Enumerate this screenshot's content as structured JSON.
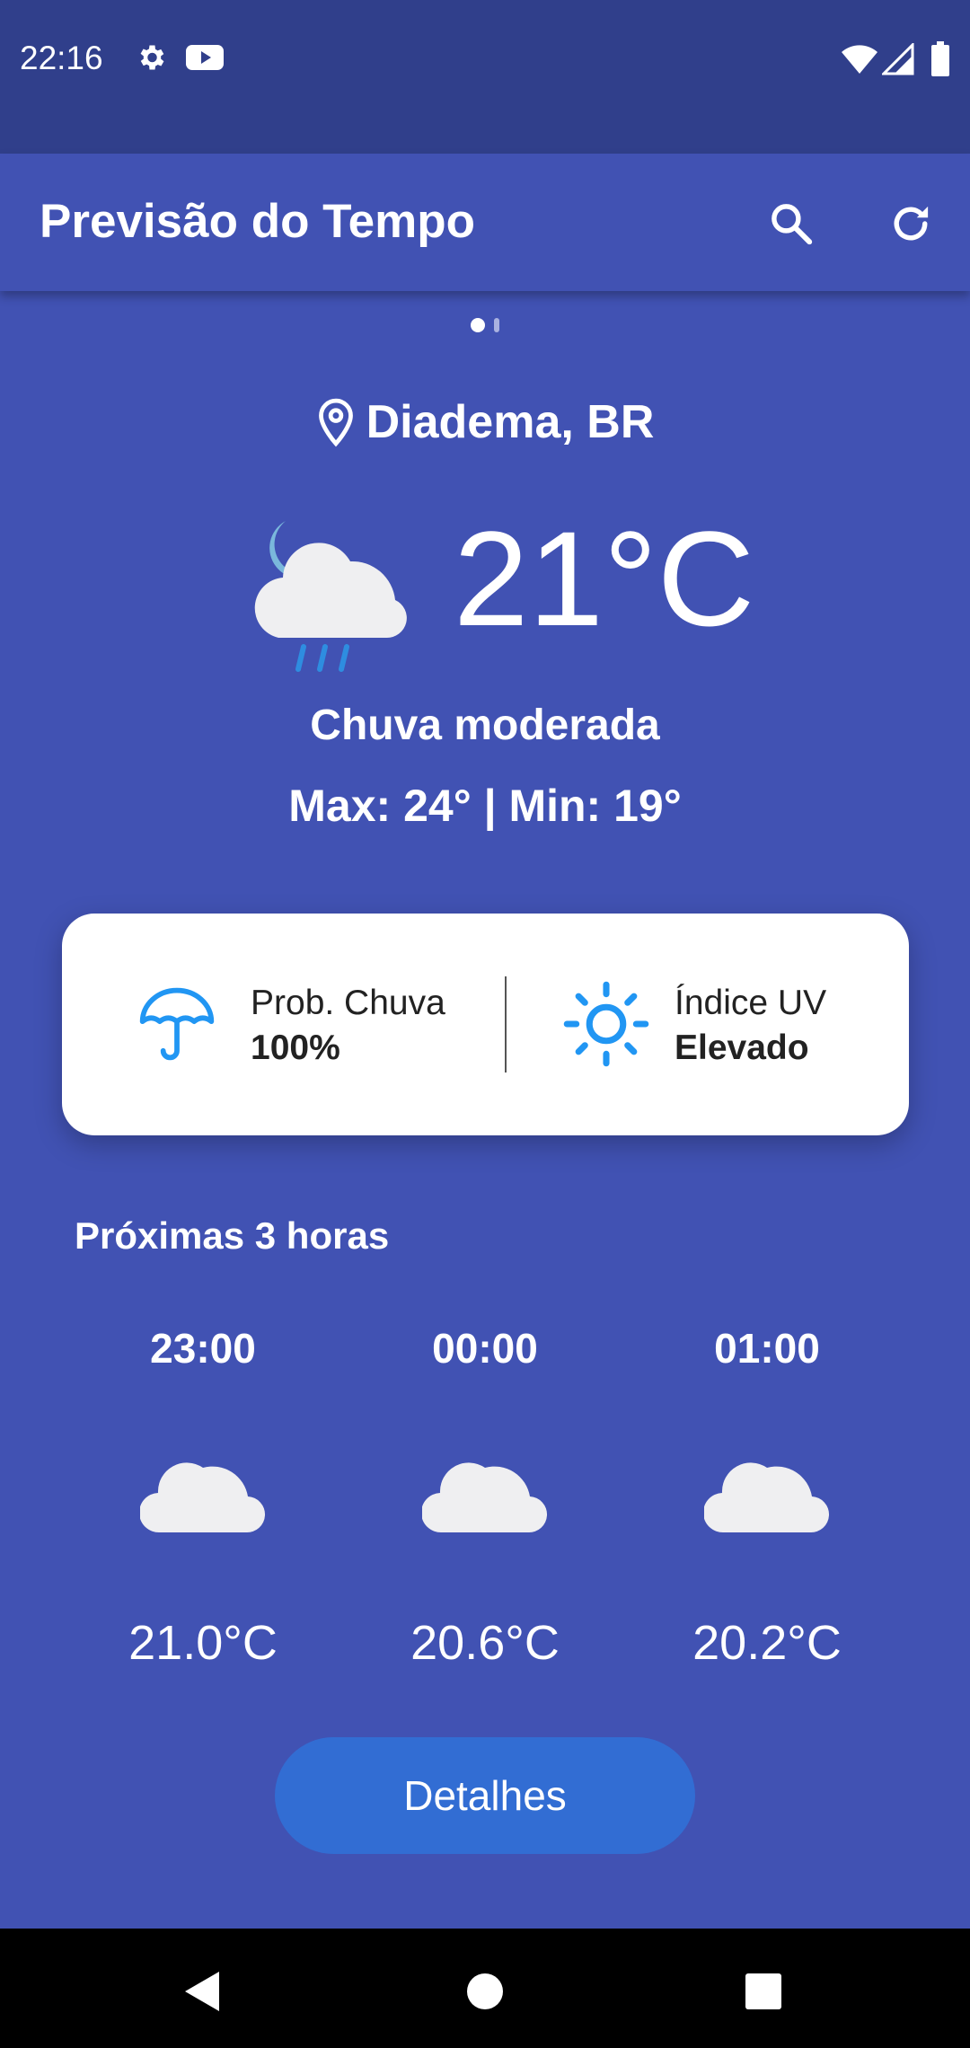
{
  "status_bar": {
    "time": "22:16",
    "icons": [
      "settings-icon",
      "youtube-icon",
      "wifi-icon",
      "signal-icon",
      "battery-icon"
    ]
  },
  "app_bar": {
    "title": "Previsão do Tempo",
    "actions": [
      "search-icon",
      "refresh-icon"
    ]
  },
  "pager": {
    "pages": 2,
    "active": 0
  },
  "location": {
    "name": "Diadema, BR",
    "icon": "location-pin-icon"
  },
  "current": {
    "icon": "cloud-rain-night-icon",
    "temperature": "21°C",
    "condition": "Chuva moderada",
    "max_min": "Max: 24° | Min: 19°"
  },
  "info_card": {
    "rain": {
      "icon": "umbrella-icon",
      "label": "Prob. Chuva",
      "value": "100%"
    },
    "uv": {
      "icon": "sun-icon",
      "label": "Índice UV",
      "value": "Elevado"
    }
  },
  "forecast": {
    "title": "Próximas 3 horas",
    "hours": [
      {
        "time": "23:00",
        "icon": "cloud-icon",
        "temp": "21.0°C"
      },
      {
        "time": "00:00",
        "icon": "cloud-icon",
        "temp": "20.6°C"
      },
      {
        "time": "01:00",
        "icon": "cloud-icon",
        "temp": "20.2°C"
      }
    ]
  },
  "details_button": {
    "label": "Detalhes"
  },
  "nav_bar": {
    "buttons": [
      "back-icon",
      "home-icon",
      "recents-icon"
    ]
  },
  "colors": {
    "background": "#4152b3",
    "status_bar": "#303f8b",
    "button": "#326dd3",
    "accent_icon": "#2196f3"
  }
}
